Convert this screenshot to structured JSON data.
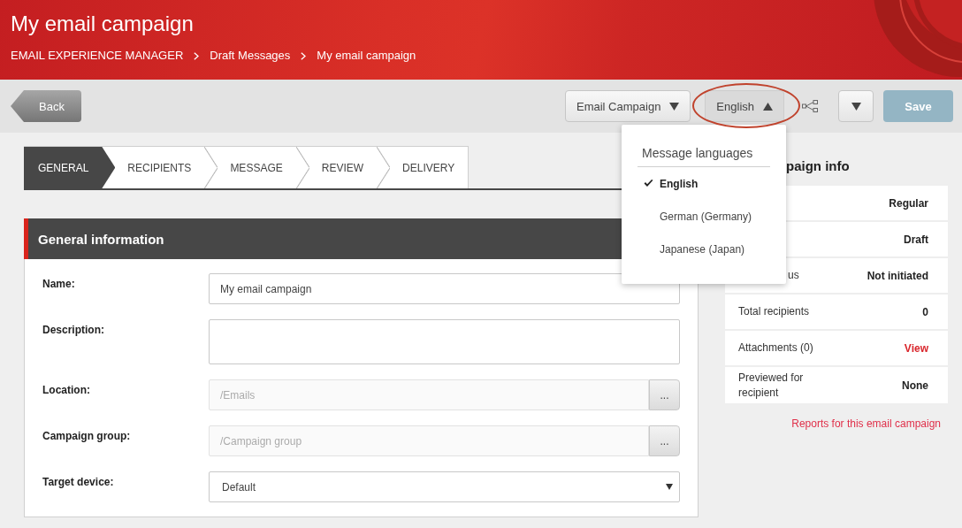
{
  "header": {
    "title": "My email campaign",
    "breadcrumb": [
      "EMAIL EXPERIENCE MANAGER",
      "Draft Messages",
      "My email campaign"
    ]
  },
  "toolbar": {
    "back_button": "Back",
    "campaign_type_menu": {
      "label": "Email Campaign",
      "expanded": false
    },
    "language_menu": {
      "label": "English",
      "expanded": true,
      "highlighted": true,
      "title": "Message languages",
      "options": [
        {
          "label": "English",
          "selected": true
        },
        {
          "label": "German (Germany)",
          "selected": false
        },
        {
          "label": "Japanese (Japan)",
          "selected": false
        }
      ]
    },
    "save_button": {
      "label": "Save",
      "disabled": true
    }
  },
  "wizard": {
    "steps": [
      {
        "label": "GENERAL",
        "selected": true
      },
      {
        "label": "RECIPIENTS",
        "selected": false
      },
      {
        "label": "MESSAGE",
        "selected": false
      },
      {
        "label": "REVIEW",
        "selected": false
      },
      {
        "label": "DELIVERY",
        "selected": false
      }
    ]
  },
  "general_information": {
    "title": "General information",
    "fields": [
      {
        "kind": "text",
        "label": "Name:",
        "value": "My email campaign",
        "disabled": false
      },
      {
        "kind": "textarea",
        "label": "Description:",
        "disabled": false
      },
      {
        "kind": "picker",
        "label": "Location:",
        "value": "/Emails",
        "disabled": true,
        "button": "..."
      },
      {
        "kind": "picker",
        "label": "Campaign group:",
        "value": "/Campaign group",
        "disabled": true,
        "button": "..."
      },
      {
        "kind": "select",
        "label": "Target device:",
        "value": "Default",
        "disabled": false
      }
    ]
  },
  "campaign_info": {
    "title": "paign info",
    "rows": [
      {
        "kind": "text",
        "value": "Regular"
      },
      {
        "kind": "text",
        "value": "Draft"
      },
      {
        "kind": "text",
        "label": "us",
        "value": "Not initiated"
      },
      {
        "kind": "text",
        "label": "Total recipients",
        "value": "0"
      },
      {
        "kind": "link",
        "label": "Attachments (0)",
        "value": "View"
      },
      {
        "kind": "text",
        "label": "Previewed for recipient",
        "value": "None"
      }
    ],
    "reports_link": "Reports for this email campaign"
  }
}
